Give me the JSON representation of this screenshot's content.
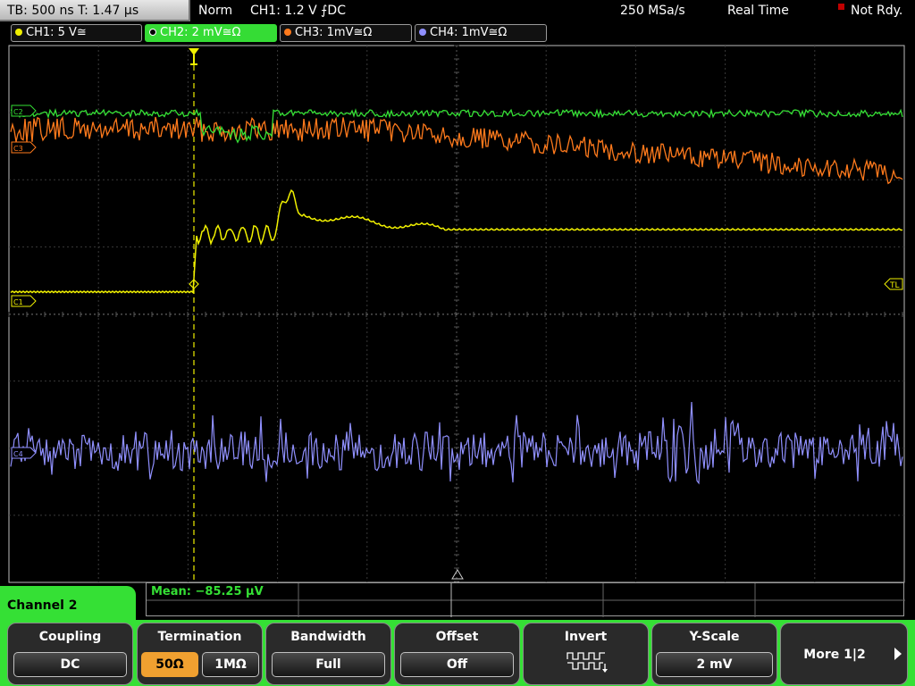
{
  "statusbar": {
    "timebase": "TB: 500 ns   T: 1.47 µs",
    "mode": "Norm",
    "trigger": "CH1: 1.2 V ⨍DC",
    "samplerate": "250 MSa/s",
    "acquisition": "Real Time",
    "status": "Not Rdy."
  },
  "channels": [
    {
      "label": "CH1: 5 V≅",
      "color": "#f0f000",
      "marker": "C1"
    },
    {
      "label": "CH2: 2 mV≅Ω",
      "color": "#35e035",
      "marker": "C2",
      "active": true
    },
    {
      "label": "CH3: 1mV≅Ω",
      "color": "#ff7a1c",
      "marker": "C3"
    },
    {
      "label": "CH4: 1mV≅Ω",
      "color": "#9090ff",
      "marker": "C4"
    }
  ],
  "trigger_level_marker": "TL",
  "measurement": "Mean: −85.25 µV",
  "menu": {
    "channel_tab": "Channel 2",
    "coupling": {
      "title": "Coupling",
      "value": "DC"
    },
    "termination": {
      "title": "Termination",
      "options": [
        "50Ω",
        "1MΩ"
      ],
      "selected": "50Ω"
    },
    "bandwidth": {
      "title": "Bandwidth",
      "value": "Full"
    },
    "offset": {
      "title": "Offset",
      "value": "Off"
    },
    "invert": {
      "title": "Invert",
      "icon": "invert-wave-icon"
    },
    "yscale": {
      "title": "Y-Scale",
      "value": "2 mV"
    },
    "more": {
      "label": "More 1|2",
      "icon": "arrow-right-icon"
    }
  },
  "colors": {
    "ch1": "#f0f000",
    "ch2": "#35e035",
    "ch3": "#ff7a1c",
    "ch4": "#9090ff",
    "menu_accent": "#35e035",
    "selected_option": "#f0a030"
  }
}
